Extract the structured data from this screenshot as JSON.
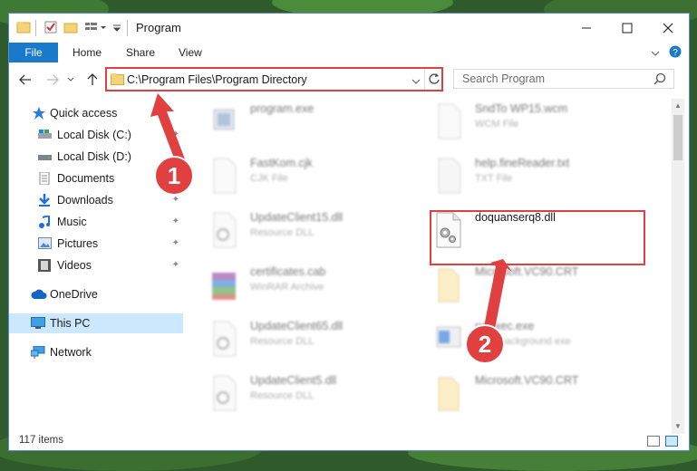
{
  "window": {
    "title": "Program"
  },
  "ribbon": {
    "tabs": [
      "File",
      "Home",
      "Share",
      "View"
    ]
  },
  "address": {
    "path": "C:\\Program Files\\Program Directory"
  },
  "search": {
    "placeholder": "Search Program"
  },
  "sidebar": {
    "items": [
      {
        "label": "Quick access",
        "icon": "star-icon"
      },
      {
        "label": "Local Disk (C:)",
        "icon": "drive-icon"
      },
      {
        "label": "Local Disk (D:)",
        "icon": "drive-icon"
      },
      {
        "label": "Documents",
        "icon": "documents-icon"
      },
      {
        "label": "Downloads",
        "icon": "download-icon"
      },
      {
        "label": "Music",
        "icon": "music-icon"
      },
      {
        "label": "Pictures",
        "icon": "pictures-icon"
      },
      {
        "label": "Videos",
        "icon": "videos-icon"
      },
      {
        "label": "OneDrive",
        "icon": "cloud-icon"
      },
      {
        "label": "This PC",
        "icon": "computer-icon"
      },
      {
        "label": "Network",
        "icon": "network-icon"
      }
    ]
  },
  "files": [
    {
      "name": "program.exe",
      "type": ""
    },
    {
      "name": "SndTo WP15.wcm",
      "type": "WCM File"
    },
    {
      "name": "FastKom.cjk",
      "type": "CJK File"
    },
    {
      "name": "help.fineReader.txt",
      "type": "TXT File"
    },
    {
      "name": "UpdateClient15.dll",
      "type": "Resource DLL"
    },
    {
      "name": "doquanserq8.dll",
      "type": ""
    },
    {
      "name": "certificates.cab",
      "type": "WinRAR Archive"
    },
    {
      "name": "Microsoft.VC90.CRT",
      "type": ""
    },
    {
      "name": "UpdateClient65.dll",
      "type": "Resource DLL"
    },
    {
      "name": "ppExec.exe",
      "type": "SWT background exe"
    },
    {
      "name": "UpdateClient5.dll",
      "type": "Resource DLL"
    },
    {
      "name": "Microsoft.VC90.CRT",
      "type": ""
    }
  ],
  "status": {
    "count": "117 items"
  },
  "annotations": {
    "step1": "1",
    "step2": "2"
  },
  "colors": {
    "accent": "#1979ca",
    "highlight": "#e04040",
    "selection": "#cce8ff"
  }
}
